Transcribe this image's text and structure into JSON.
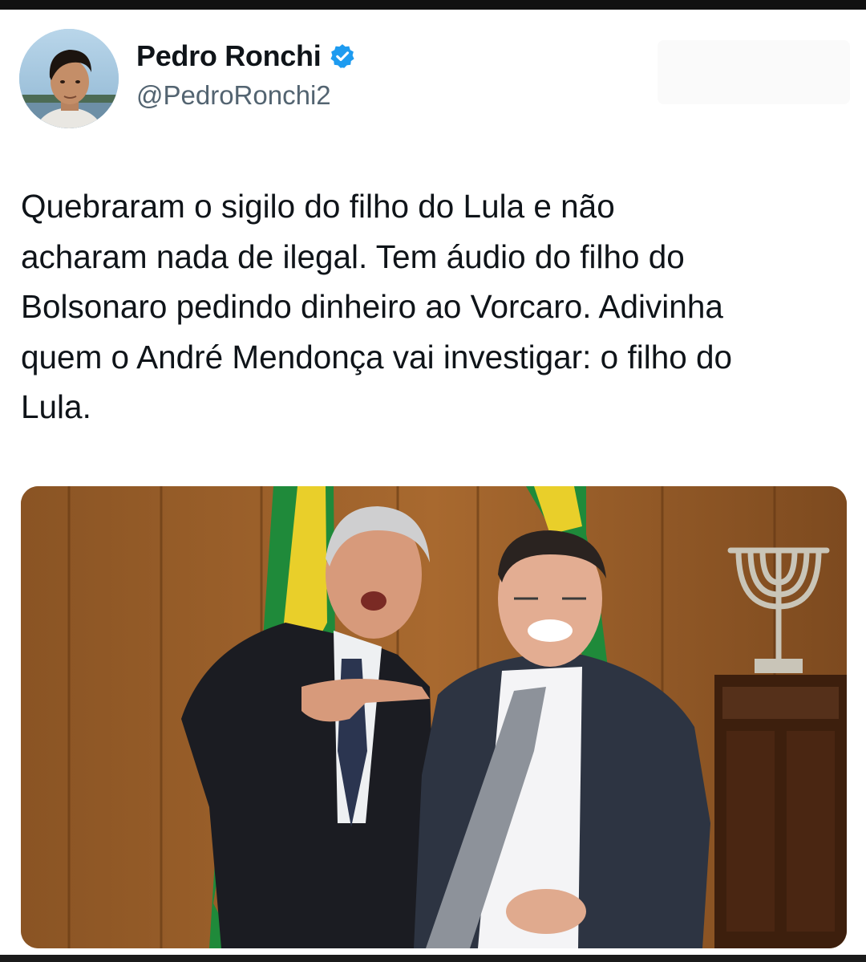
{
  "tweet": {
    "author": {
      "display_name": "Pedro Ronchi",
      "handle": "@PedroRonchi2",
      "verified": true,
      "avatar_icon": "profile-photo",
      "verified_icon": "verified-badge-icon"
    },
    "text": "Quebraram o sigilo do filho do Lula e não\nacharam nada de ilegal. Tem áudio do filho do\nBolsonaro pedindo dinheiro ao Vorcaro. Adivinha\nquem o André Mendonça vai investigar: o filho do\nLula.",
    "media": {
      "type": "photo"
    }
  },
  "colors": {
    "text_primary": "#0f1419",
    "text_secondary": "#536471",
    "verified_blue": "#1d9bf0",
    "background": "#ffffff"
  }
}
